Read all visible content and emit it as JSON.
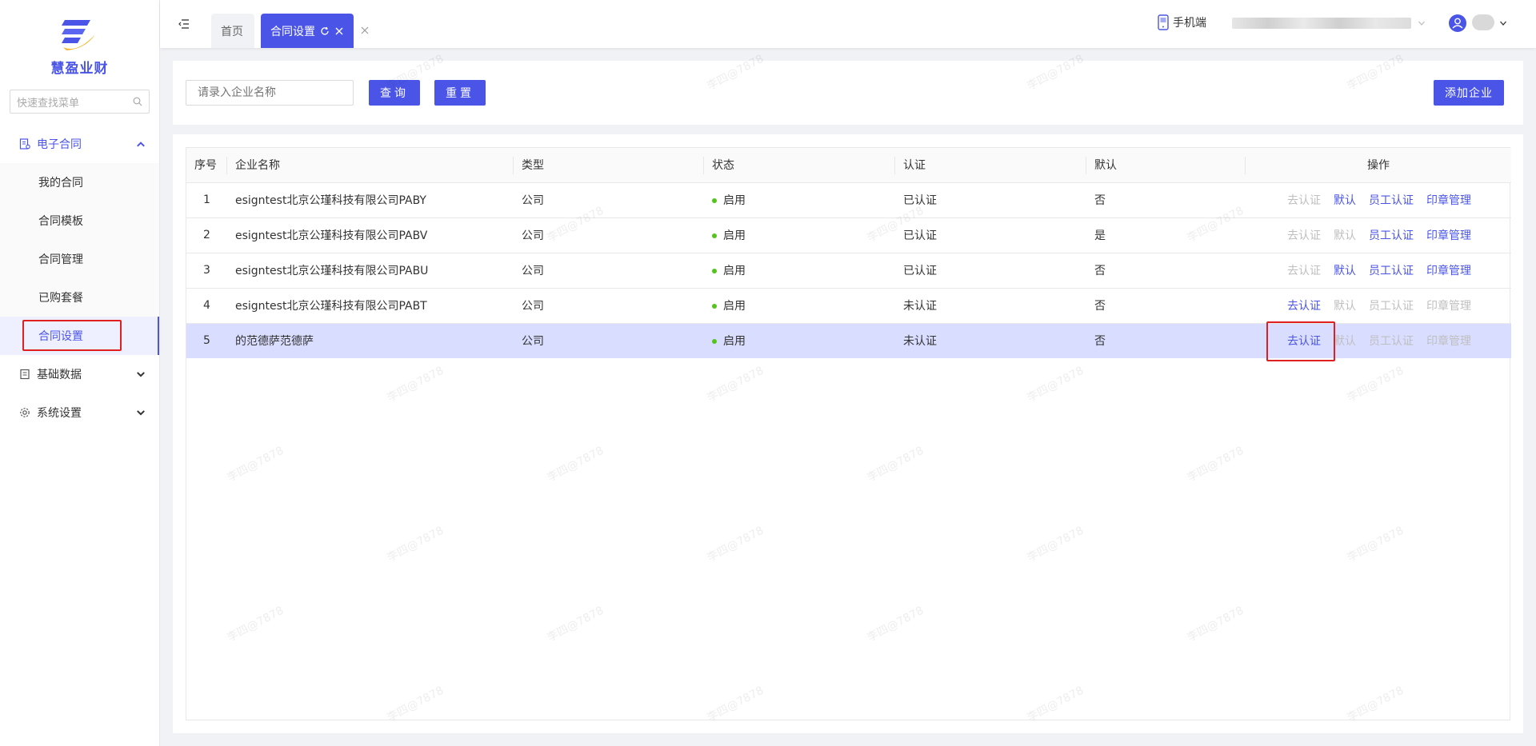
{
  "sidebar": {
    "brand": "慧盈业财",
    "search_placeholder": "快速查找菜单",
    "groups": [
      {
        "label": "电子合同",
        "expanded": true
      },
      {
        "label": "基础数据",
        "expanded": false
      },
      {
        "label": "系统设置",
        "expanded": false
      }
    ],
    "submenu": [
      {
        "label": "我的合同"
      },
      {
        "label": "合同模板"
      },
      {
        "label": "合同管理"
      },
      {
        "label": "已购套餐"
      },
      {
        "label": "合同设置",
        "selected": true
      }
    ]
  },
  "topbar": {
    "tabs": [
      {
        "label": "首页"
      },
      {
        "label": "合同设置",
        "active": true
      }
    ],
    "mobile_label": "手机端"
  },
  "search": {
    "company_placeholder": "请录入企业名称",
    "query_label": "查询",
    "reset_label": "重置",
    "add_label": "添加企业"
  },
  "table": {
    "headers": {
      "index": "序号",
      "name": "企业名称",
      "type": "类型",
      "status": "状态",
      "cert": "认证",
      "default": "默认",
      "ops": "操作"
    },
    "op_labels": {
      "certify": "去认证",
      "set_default": "默认",
      "staff_cert": "员工认证",
      "seal_mgmt": "印章管理"
    },
    "rows": [
      {
        "index": "1",
        "name": "esigntest北京公瑾科技有限公司PABY",
        "type": "公司",
        "status": "启用",
        "cert": "已认证",
        "default": "否"
      },
      {
        "index": "2",
        "name": "esigntest北京公瑾科技有限公司PABV",
        "type": "公司",
        "status": "启用",
        "cert": "已认证",
        "default": "是"
      },
      {
        "index": "3",
        "name": "esigntest北京公瑾科技有限公司PABU",
        "type": "公司",
        "status": "启用",
        "cert": "已认证",
        "default": "否"
      },
      {
        "index": "4",
        "name": "esigntest北京公瑾科技有限公司PABT",
        "type": "公司",
        "status": "启用",
        "cert": "未认证",
        "default": "否"
      },
      {
        "index": "5",
        "name": "的范德萨范德萨",
        "type": "公司",
        "status": "启用",
        "cert": "未认证",
        "default": "否"
      }
    ]
  },
  "watermark": "李四@7878",
  "colors": {
    "accent": "#4a55e8",
    "highlight_row": "#d9ddff",
    "status_dot": "#52c41a",
    "annotation": "#e02020"
  }
}
